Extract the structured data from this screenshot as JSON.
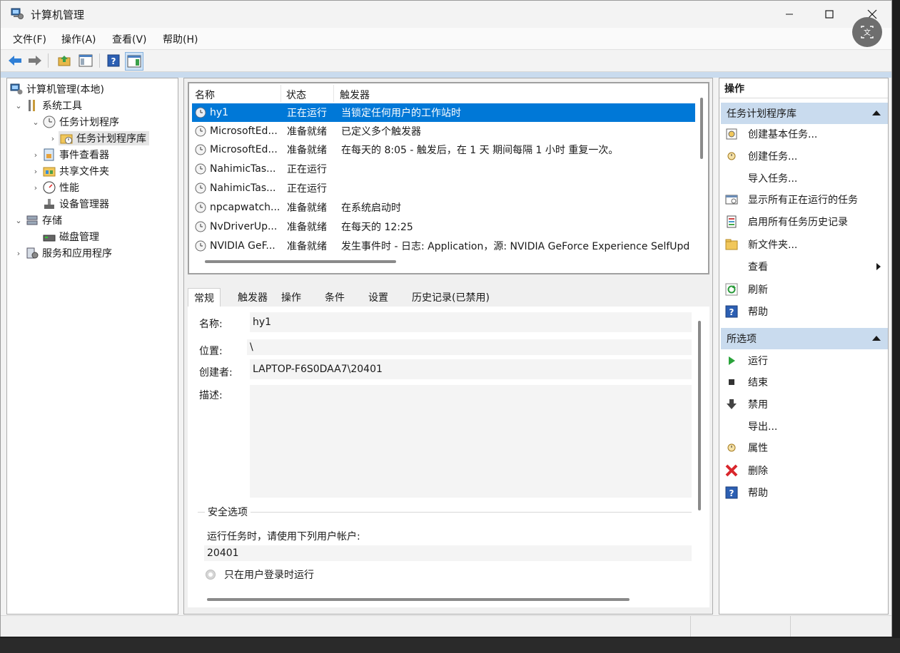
{
  "window": {
    "title": "计算机管理"
  },
  "menu": [
    "文件(F)",
    "操作(A)",
    "查看(V)",
    "帮助(H)"
  ],
  "toolbar": [
    "back-icon",
    "forward-icon",
    "up-folder-icon",
    "show-hide-tree-icon",
    "help-icon",
    "show-hide-action-pane-icon"
  ],
  "tree": {
    "root": "计算机管理(本地)",
    "system_tools": "系统工具",
    "task_scheduler": "任务计划程序",
    "task_library": "任务计划程序库",
    "event_viewer": "事件查看器",
    "shared_folders": "共享文件夹",
    "performance": "性能",
    "device_manager": "设备管理器",
    "storage": "存储",
    "disk_management": "磁盘管理",
    "services": "服务和应用程序"
  },
  "task_list": {
    "columns": [
      "名称",
      "状态",
      "触发器"
    ],
    "rows": [
      {
        "name": "hy1",
        "status": "正在运行",
        "trigger": "当锁定任何用户的工作站时"
      },
      {
        "name": "MicrosoftEd...",
        "status": "准备就绪",
        "trigger": "已定义多个触发器"
      },
      {
        "name": "MicrosoftEd...",
        "status": "准备就绪",
        "trigger": "在每天的 8:05 - 触发后，在 1 天 期间每隔 1 小时 重复一次。"
      },
      {
        "name": "NahimicTas...",
        "status": "正在运行",
        "trigger": ""
      },
      {
        "name": "NahimicTas...",
        "status": "正在运行",
        "trigger": ""
      },
      {
        "name": "npcapwatch...",
        "status": "准备就绪",
        "trigger": "在系统启动时"
      },
      {
        "name": "NvDriverUp...",
        "status": "准备就绪",
        "trigger": "在每天的 12:25"
      },
      {
        "name": "NVIDIA GeF...",
        "status": "准备就绪",
        "trigger": "发生事件时 - 日志: Application，源: NVIDIA GeForce Experience SelfUpd"
      }
    ]
  },
  "tabs": [
    "常规",
    "触发器",
    "操作",
    "条件",
    "设置",
    "历史记录(已禁用)"
  ],
  "general": {
    "name_label": "名称:",
    "name_value": "hy1",
    "location_label": "位置:",
    "location_value": "\\",
    "author_label": "创建者:",
    "author_value": "LAPTOP-F6S0DAA7\\20401",
    "desc_label": "描述:",
    "security_title": "安全选项",
    "run_as_text": "运行任务时，请使用下列用户帐户:",
    "run_as_user": "20401",
    "only_logged_on": "只在用户登录时运行"
  },
  "actions": {
    "title": "操作",
    "section1": "任务计划程序库",
    "items1": [
      "创建基本任务...",
      "创建任务...",
      "导入任务...",
      "显示所有正在运行的任务",
      "启用所有任务历史记录",
      "新文件夹...",
      "查看",
      "刷新",
      "帮助"
    ],
    "section2": "所选项",
    "items2": [
      "运行",
      "结束",
      "禁用",
      "导出...",
      "属性",
      "删除",
      "帮助"
    ]
  }
}
